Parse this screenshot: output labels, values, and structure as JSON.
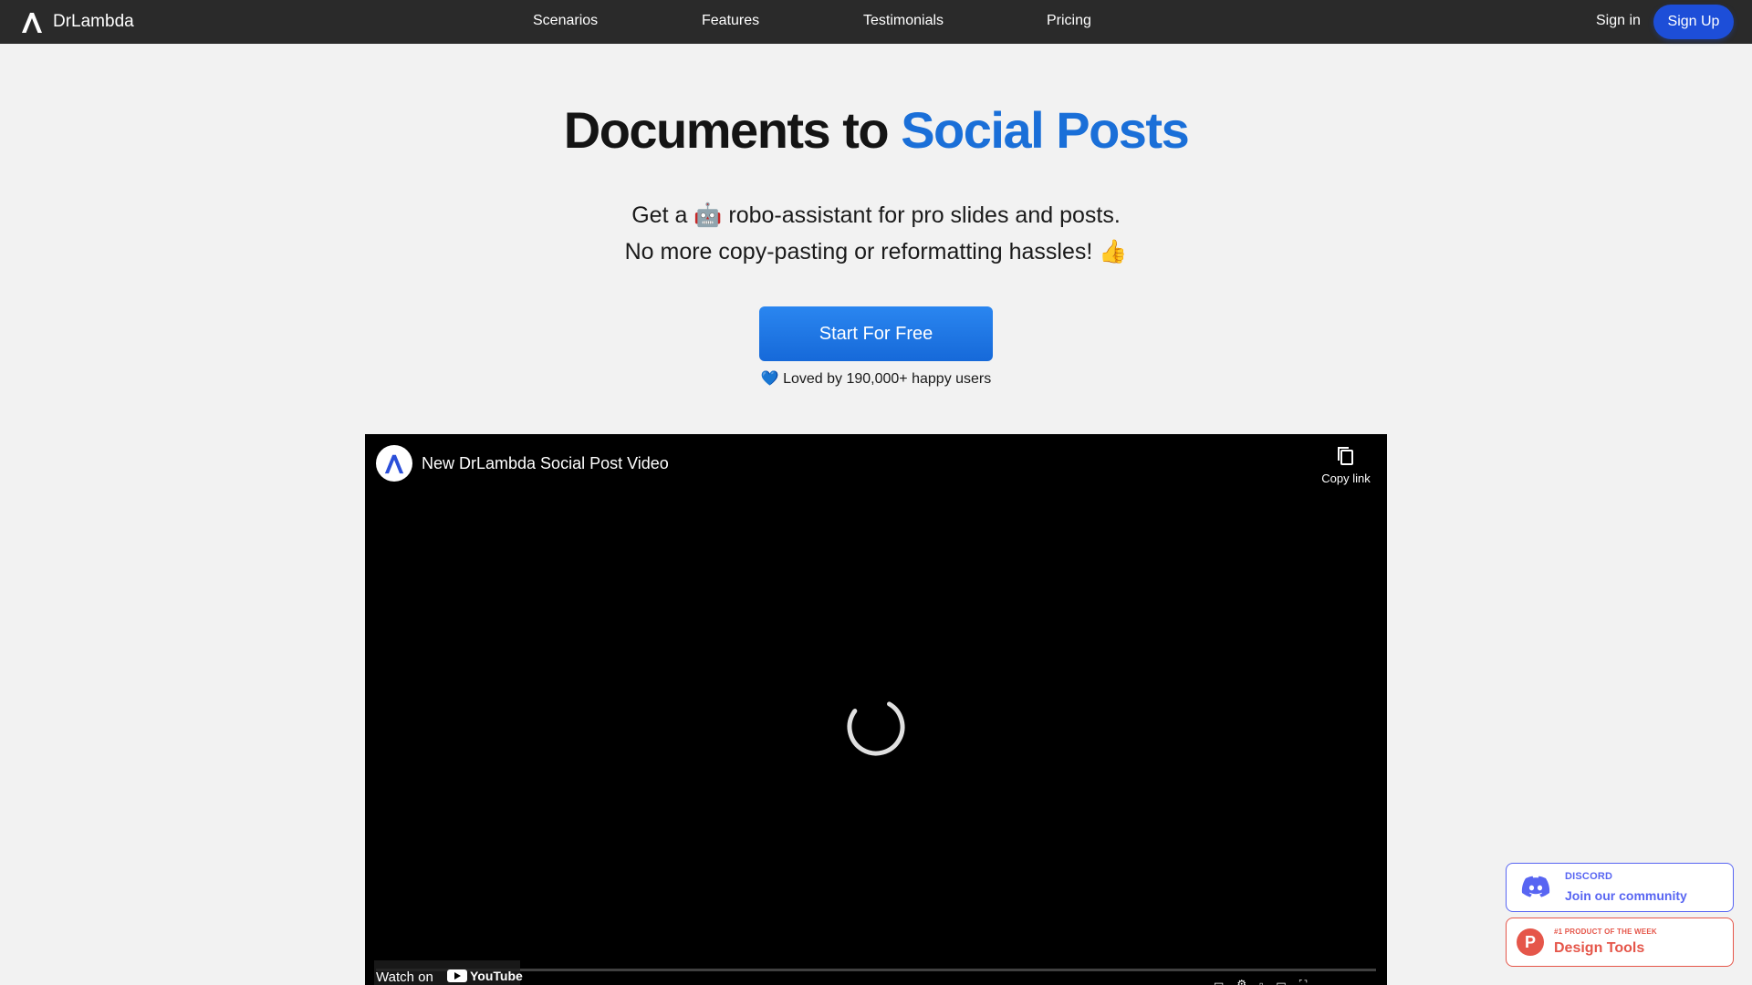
{
  "nav": {
    "brand": "DrLambda",
    "links": [
      "Scenarios",
      "Features",
      "Testimonials",
      "Pricing"
    ],
    "signin": "Sign in",
    "signup": "Sign Up"
  },
  "hero": {
    "title_main": "Documents to ",
    "title_accent": "Social Posts",
    "subtitle_line1": "Get a 🤖 robo-assistant for pro slides and posts.",
    "subtitle_line2": "No more copy-pasting or reformatting hassles! 👍",
    "cta": "Start For Free",
    "loved": "💙 Loved by 190,000+ happy users"
  },
  "video": {
    "title": "New DrLambda Social Post Video",
    "copy_link": "Copy link",
    "watch_on": "Watch on",
    "youtube": "YouTube"
  },
  "badges": {
    "discord_small": "DISCORD",
    "discord_big": "Join our community",
    "ph_small": "#1 PRODUCT OF THE WEEK",
    "ph_big": "Design Tools",
    "ph_letter": "P"
  },
  "colors": {
    "nav_bg": "#2a2a2a",
    "accent_blue": "#1a6fd8",
    "signup_blue": "#1d4ed8",
    "discord": "#5865f2",
    "producthunt": "#e5564a"
  }
}
